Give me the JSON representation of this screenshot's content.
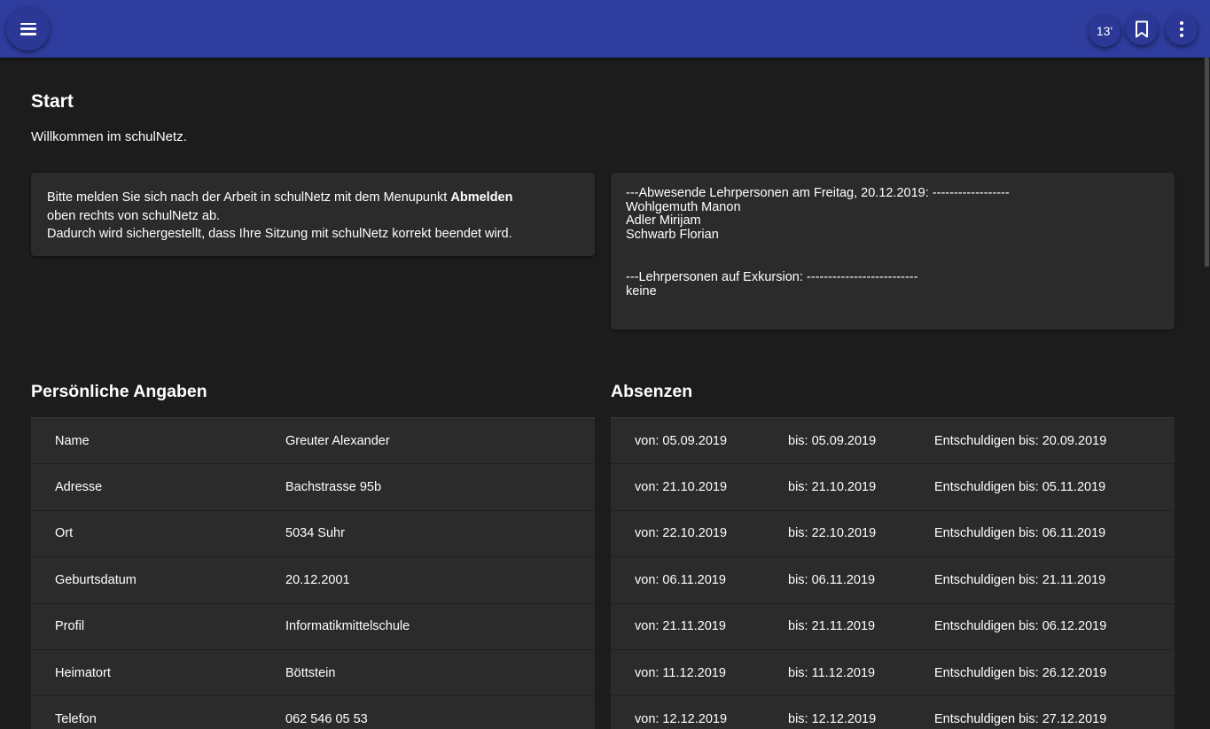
{
  "header": {
    "timer": "13'"
  },
  "page": {
    "title": "Start",
    "welcome": "Willkommen im schulNetz."
  },
  "notice": {
    "text_before": "Bitte melden Sie sich nach der Arbeit in schulNetz mit dem Menupunkt ",
    "bold": "Abmelden",
    "text_after": "oben rechts von schulNetz ab.",
    "line2": "Dadurch wird sichergestellt, dass Ihre Sitzung mit schulNetz korrekt beendet wird."
  },
  "absent_teachers": {
    "header": "---Abwesende Lehrpersonen am Freitag, 20.12.2019: ------------------",
    "names": [
      "Wohlgemuth Manon",
      "Adler Mirijam",
      "Schwarb Florian"
    ],
    "excursion_header": "---Lehrpersonen auf Exkursion: --------------------------",
    "excursion_value": "keine"
  },
  "personal": {
    "title": "Persönliche Angaben",
    "rows": [
      {
        "label": "Name",
        "value": "Greuter Alexander"
      },
      {
        "label": "Adresse",
        "value": "Bachstrasse 95b"
      },
      {
        "label": "Ort",
        "value": "5034 Suhr"
      },
      {
        "label": "Geburtsdatum",
        "value": "20.12.2001"
      },
      {
        "label": "Profil",
        "value": "Informatikmittelschule"
      },
      {
        "label": "Heimatort",
        "value": "Böttstein"
      },
      {
        "label": "Telefon",
        "value": "062 546 05 53"
      }
    ]
  },
  "absences": {
    "title": "Absenzen",
    "rows": [
      {
        "from": "von: 05.09.2019",
        "to": "bis: 05.09.2019",
        "excuse": "Entschuldigen bis: 20.09.2019"
      },
      {
        "from": "von: 21.10.2019",
        "to": "bis: 21.10.2019",
        "excuse": "Entschuldigen bis: 05.11.2019"
      },
      {
        "from": "von: 22.10.2019",
        "to": "bis: 22.10.2019",
        "excuse": "Entschuldigen bis: 06.11.2019"
      },
      {
        "from": "von: 06.11.2019",
        "to": "bis: 06.11.2019",
        "excuse": "Entschuldigen bis: 21.11.2019"
      },
      {
        "from": "von: 21.11.2019",
        "to": "bis: 21.11.2019",
        "excuse": "Entschuldigen bis: 06.12.2019"
      },
      {
        "from": "von: 11.12.2019",
        "to": "bis: 11.12.2019",
        "excuse": "Entschuldigen bis: 26.12.2019"
      },
      {
        "from": "von: 12.12.2019",
        "to": "bis: 12.12.2019",
        "excuse": "Entschuldigen bis: 27.12.2019"
      }
    ]
  }
}
